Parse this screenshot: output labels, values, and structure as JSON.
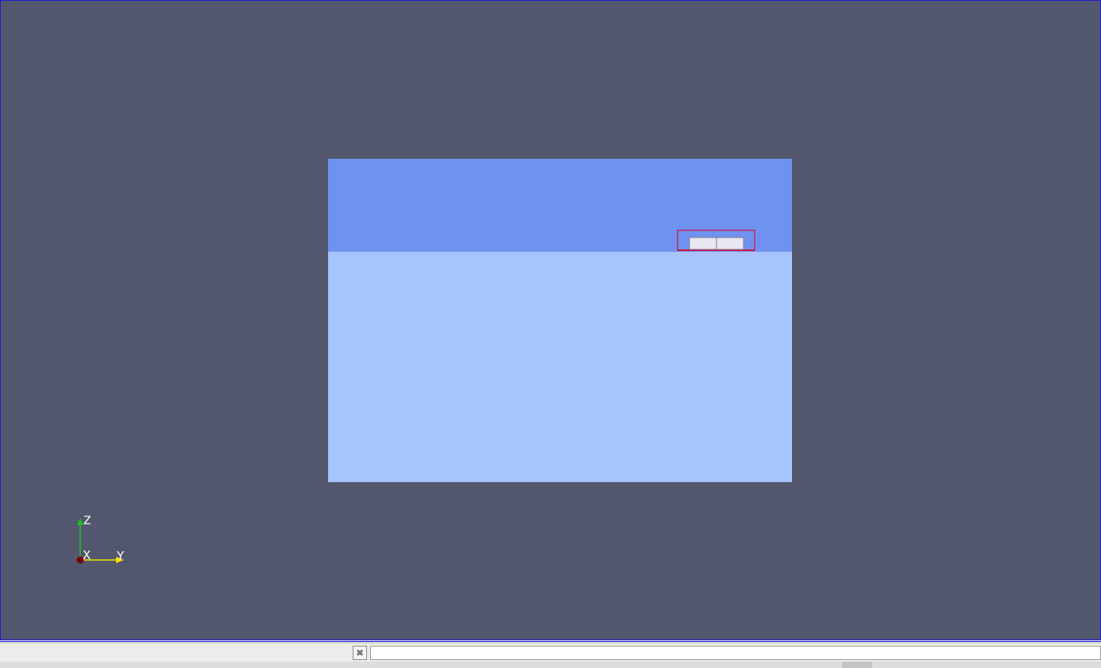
{
  "viewport": {
    "background_color": "#52576e",
    "border_color": "#1c1cd8"
  },
  "scene": {
    "sky_color": "#6f92f1",
    "water_color": "#a8c4fc",
    "selection_color": "#d01040",
    "object_color": "#e8e6ee"
  },
  "axes_widget": {
    "x_label": "X",
    "y_label": "Y",
    "z_label": "Z",
    "x_color": "#7a0000",
    "y_color": "#f0e000",
    "z_color": "#20c020"
  },
  "statusbar": {
    "clear_icon": "close-icon",
    "clear_glyph": "✖",
    "message": ""
  }
}
